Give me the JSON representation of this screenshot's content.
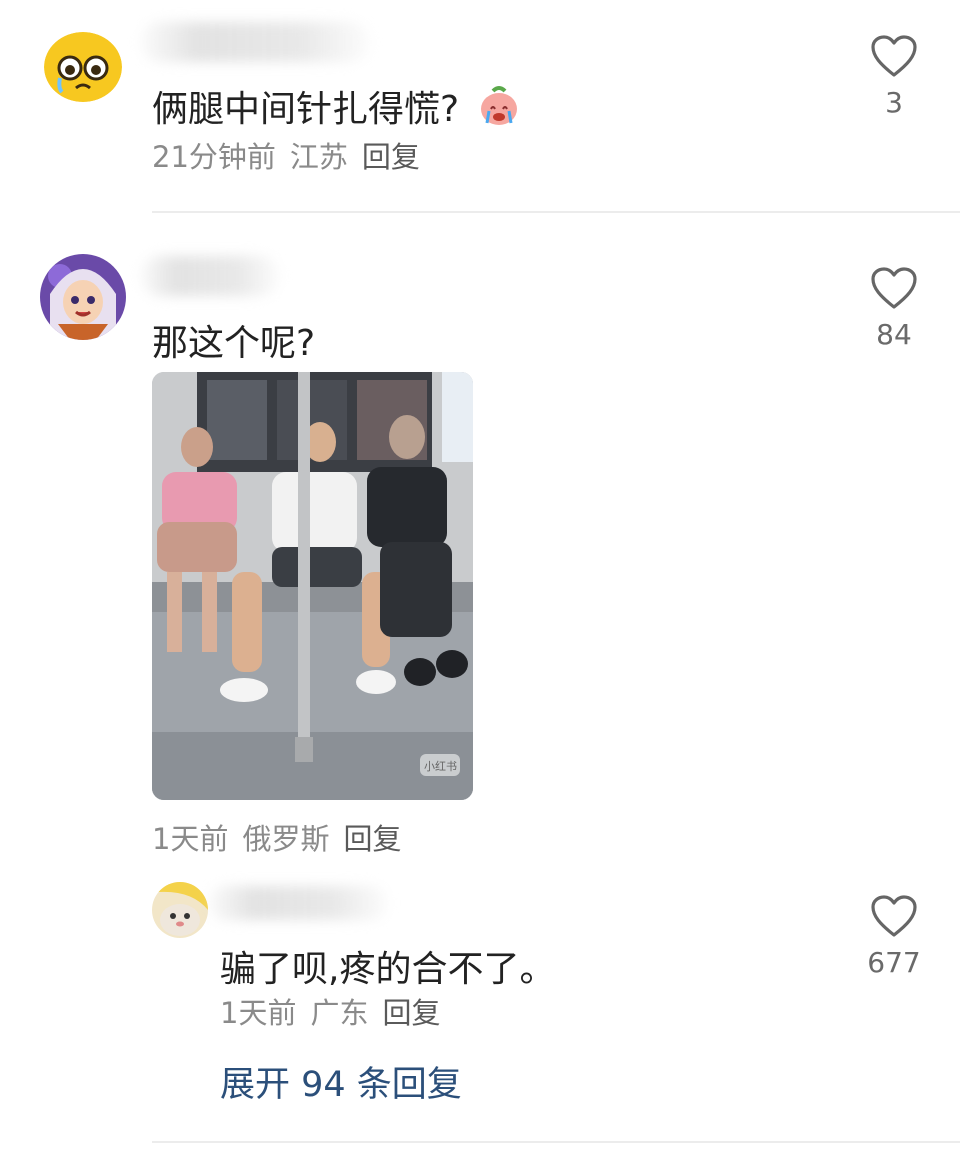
{
  "comments": [
    {
      "text": "俩腿中间针扎得慌?",
      "emoji": "crying-peach-emoji",
      "time": "21分钟前",
      "location": "江苏",
      "reply_label": "回复",
      "likes": "3",
      "avatar_icon": "crying-face-avatar"
    },
    {
      "text": "那这个呢?",
      "time": "1天前",
      "location": "俄罗斯",
      "reply_label": "回复",
      "likes": "84",
      "avatar_icon": "anime-girl-avatar",
      "image": {
        "description_icon": "subway-photo",
        "watermark": "小红书"
      },
      "replies": [
        {
          "text": "骗了呗,疼的合不了。",
          "time": "1天前",
          "location": "广东",
          "reply_label": "回复",
          "likes": "677",
          "avatar_icon": "cat-avatar"
        }
      ],
      "expand_label": "展开 94 条回复"
    }
  ],
  "colors": {
    "link": "#2b4f7a",
    "meta": "#8a8a8a",
    "heart": "#666666"
  }
}
